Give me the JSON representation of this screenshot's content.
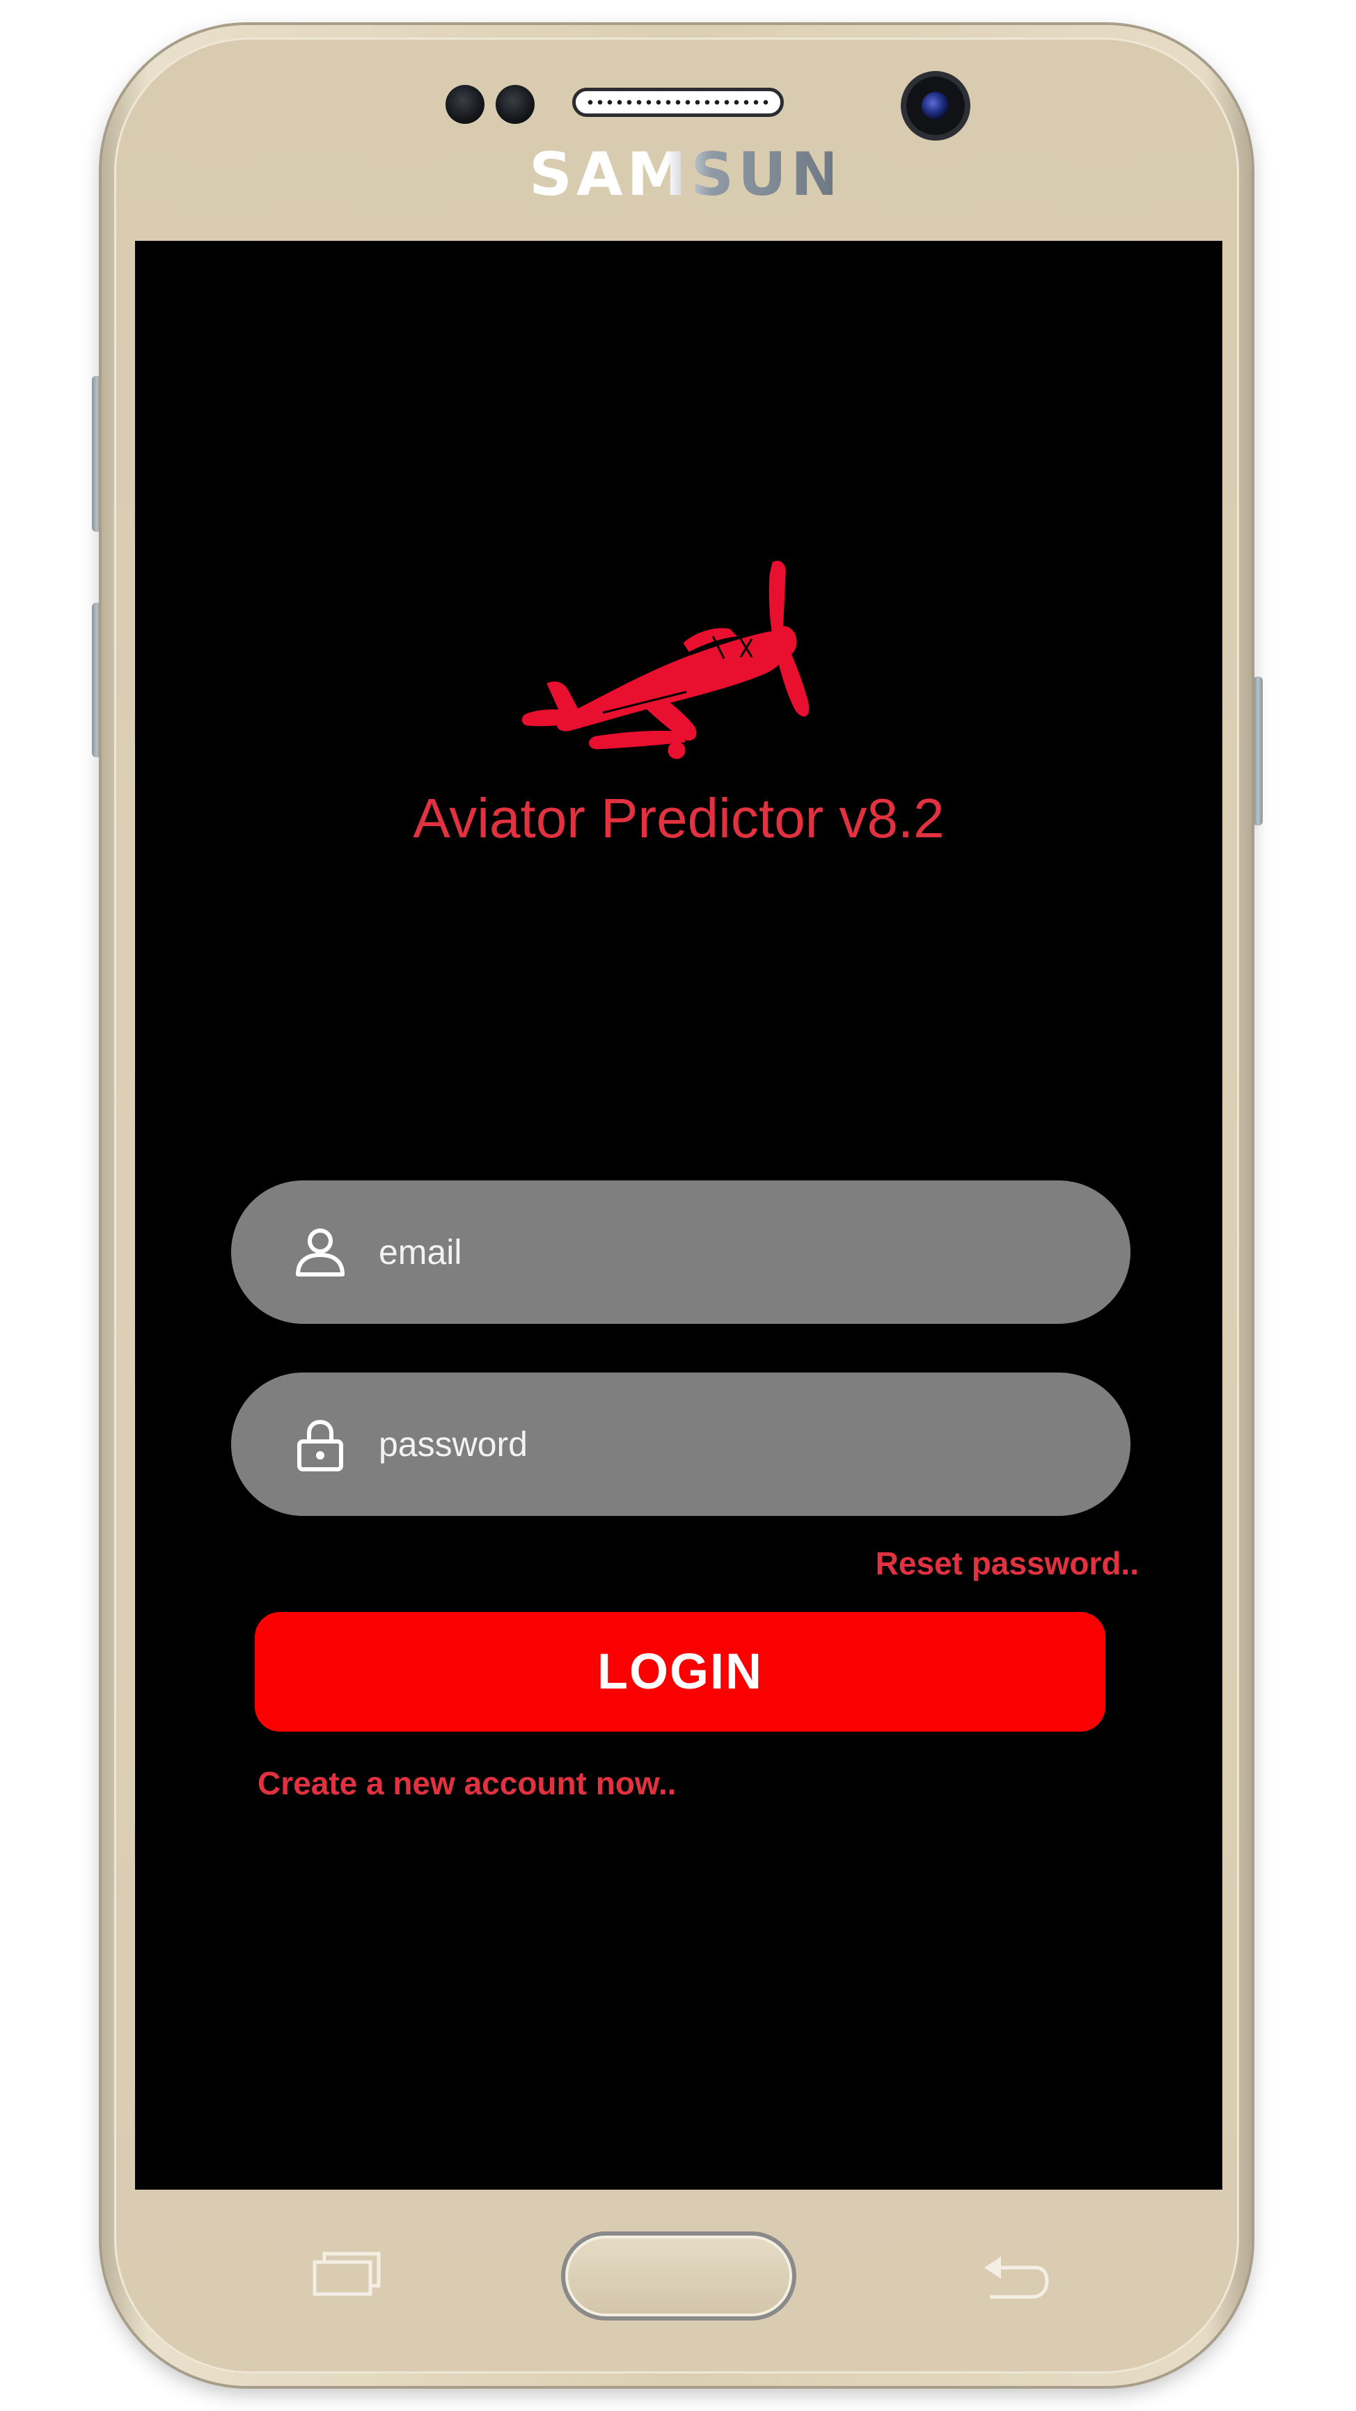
{
  "device": {
    "brand": "SAMSUNG"
  },
  "app": {
    "title": "Aviator Predictor v8.2",
    "logo_icon": "airplane-icon",
    "accent_color": "#e23240"
  },
  "login_form": {
    "email": {
      "placeholder": "email",
      "value": "",
      "icon": "user-icon"
    },
    "password": {
      "placeholder": "password",
      "value": "",
      "icon": "lock-icon"
    },
    "reset_password_label": "Reset password..",
    "login_label": "LOGIN",
    "login_color": "#fb0000",
    "create_account_label": "Create a new account now.."
  },
  "navigation_keys": {
    "recent": "recent-apps-icon",
    "home": "home-button",
    "back": "back-icon"
  }
}
